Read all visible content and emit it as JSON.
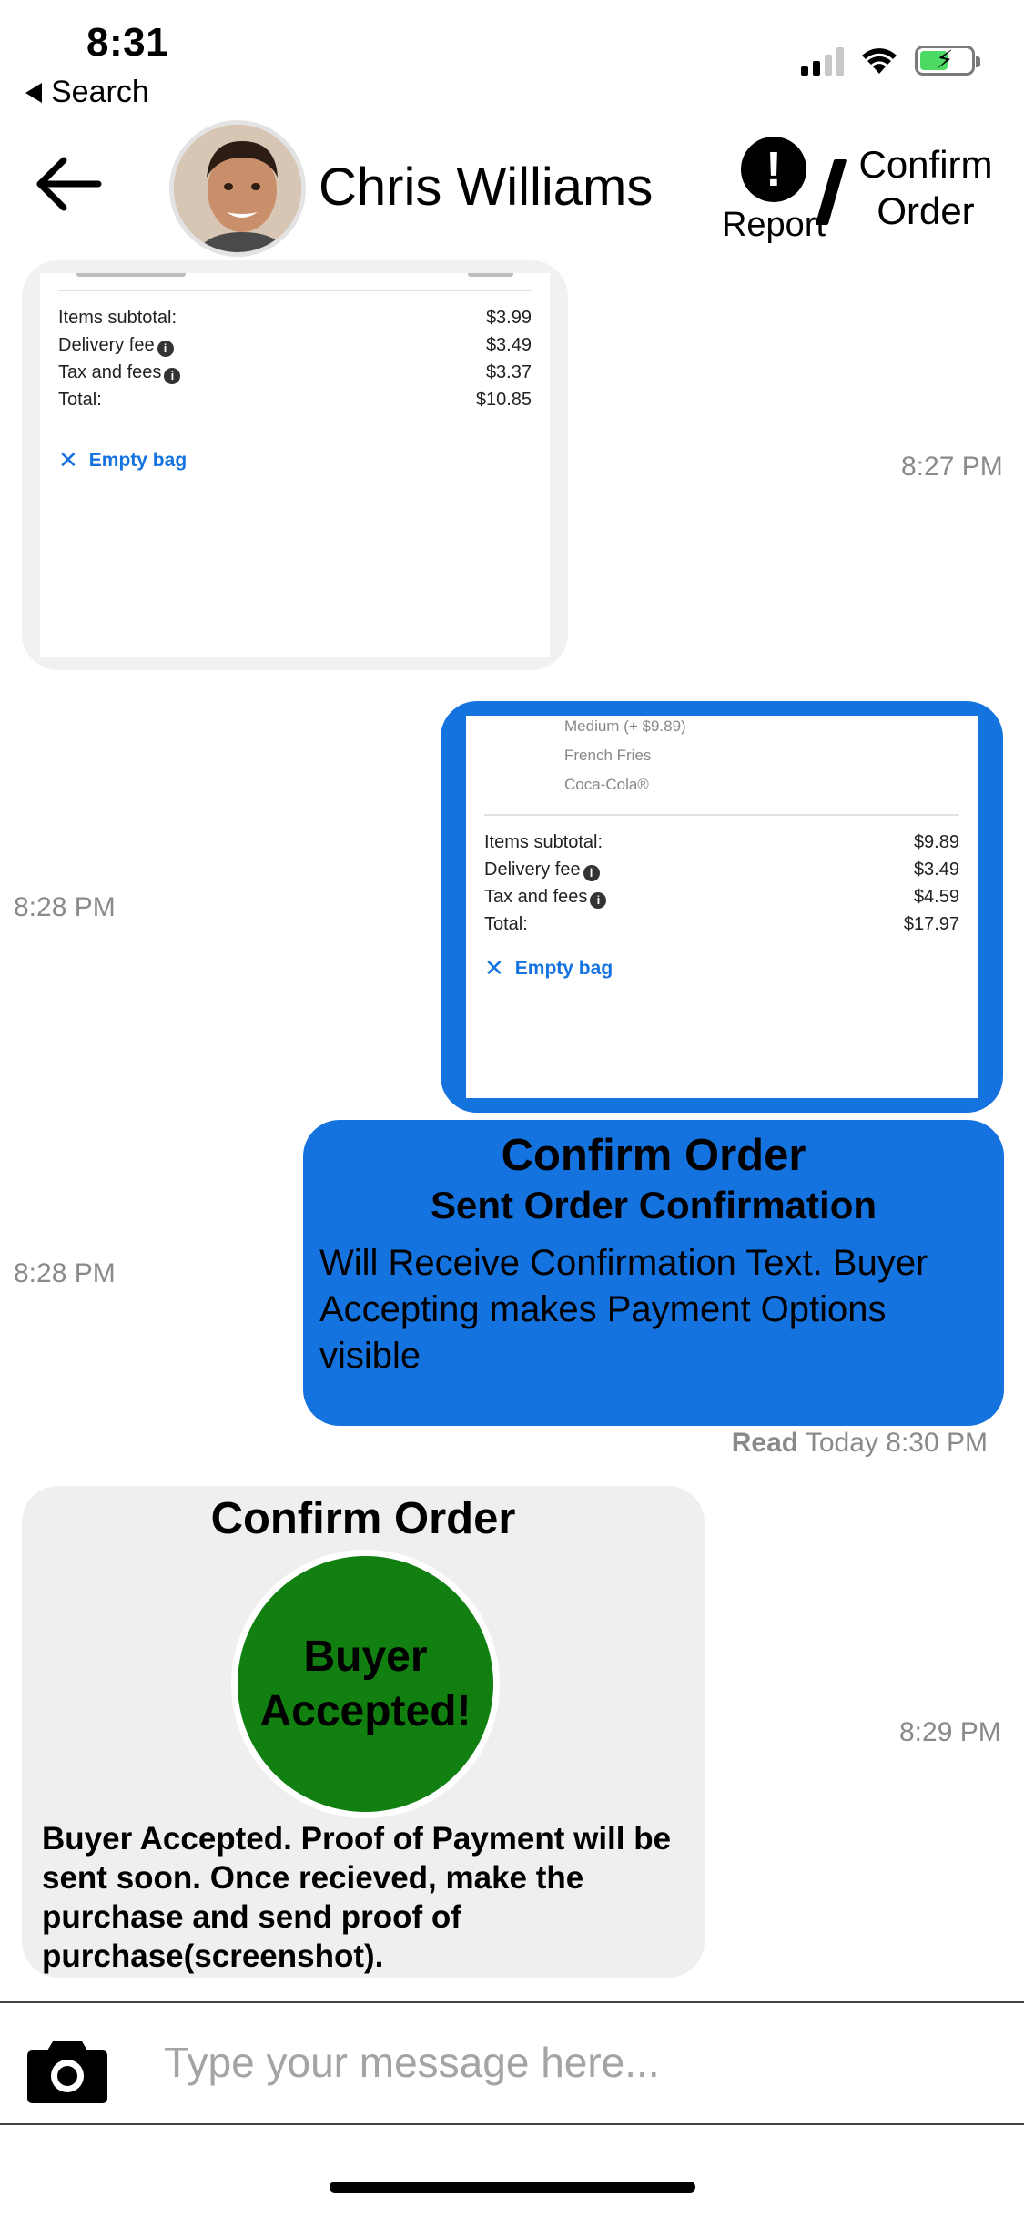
{
  "status_bar": {
    "time": "8:31",
    "back_app": "Search",
    "signal_bars": 4,
    "signal_active": 2,
    "battery_color": "#4cd964"
  },
  "header": {
    "contact_name": "Chris Williams",
    "report_label": "Report",
    "confirm_order_line1": "Confirm",
    "confirm_order_line2": "Order",
    "back_icon": "arrow-left-icon",
    "report_icon": "exclamation-circle-icon"
  },
  "messages": {
    "receipt_in": {
      "timestamp": "8:27 PM",
      "rows": [
        {
          "label": "Items subtotal:",
          "value": "$3.99",
          "info": false
        },
        {
          "label": "Delivery fee",
          "value": "$3.49",
          "info": true
        },
        {
          "label": "Tax and fees",
          "value": "$3.37",
          "info": true
        },
        {
          "label": "Total:",
          "value": "$10.85",
          "info": false
        }
      ],
      "empty_bag": "Empty bag"
    },
    "receipt_out": {
      "timestamp": "8:28 PM",
      "items": [
        "Medium (+ $9.89)",
        "French Fries",
        "Coca-Cola®"
      ],
      "rows": [
        {
          "label": "Items subtotal:",
          "value": "$9.89",
          "info": false
        },
        {
          "label": "Delivery fee",
          "value": "$3.49",
          "info": true
        },
        {
          "label": "Tax and fees",
          "value": "$4.59",
          "info": true
        },
        {
          "label": "Total:",
          "value": "$17.97",
          "info": false
        }
      ],
      "empty_bag": "Empty bag"
    },
    "confirm_sent": {
      "timestamp": "8:28 PM",
      "title": "Confirm Order",
      "subtitle": "Sent Order Confirmation",
      "body": "Will Receive Confirmation Text. Buyer Accepting makes Payment Options visible"
    },
    "read_receipt": {
      "label": "Read",
      "time": "Today 8:30 PM"
    },
    "buyer_accepted": {
      "timestamp": "8:29 PM",
      "title": "Confirm Order",
      "badge_line1": "Buyer",
      "badge_line2": "Accepted!",
      "badge_color": "#118011",
      "body": "Buyer Accepted. Proof of Payment will be sent soon. Once recieved, make the purchase and send proof of purchase(screenshot)."
    }
  },
  "composer": {
    "placeholder": "Type your message here...",
    "camera_icon": "camera-icon"
  },
  "colors": {
    "accent": "#1573e0",
    "incoming_bubble": "#efefef",
    "timestamp": "#8a8a8a"
  }
}
